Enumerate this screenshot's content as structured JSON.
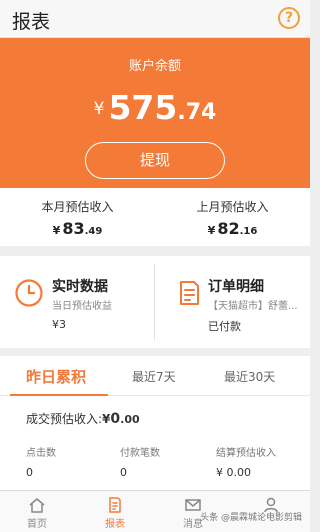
{
  "header": {
    "title": "报表",
    "help_icon": "question-circle-icon",
    "help_glyph": "?"
  },
  "balance": {
    "label": "账户余额",
    "currency": "¥",
    "amount_int": "575",
    "amount_dec": ".74",
    "withdraw_label": "提现",
    "bg_color": "#f47a38"
  },
  "estimates": {
    "this_month": {
      "label": "本月预估收入",
      "currency": "¥",
      "int": "83",
      "dec": ".49"
    },
    "last_month": {
      "label": "上月预估收入",
      "currency": "¥",
      "int": "82",
      "dec": ".16"
    }
  },
  "cards": {
    "realtime": {
      "title": "实时数据",
      "subtitle": "当日预估收益",
      "value": "¥3",
      "icon": "clock-icon"
    },
    "orders": {
      "title": "订单明细",
      "subtitle": "【天猫超市】舒蕾...",
      "value": "已付款",
      "icon": "document-icon"
    }
  },
  "stats": {
    "tabs": [
      "昨日累积",
      "最近7天",
      "最近30天"
    ],
    "deal_label": "成交预估收入:",
    "deal_currency": "¥",
    "deal_int": "0",
    "deal_dec": ".00",
    "metrics": [
      {
        "label": "点击数",
        "value": "0"
      },
      {
        "label": "付款笔数",
        "value": "0"
      },
      {
        "label": "结算预估收入",
        "value": "¥ 0.00"
      }
    ]
  },
  "tabbar": {
    "items": [
      {
        "label": "首页",
        "icon": "home-icon"
      },
      {
        "label": "报表",
        "icon": "report-icon",
        "active": true
      },
      {
        "label": "消息",
        "icon": "mail-icon"
      },
      {
        "label": "我",
        "icon": "user-icon"
      }
    ],
    "watermark": "头条 @晨霖城论电影剪辑"
  }
}
